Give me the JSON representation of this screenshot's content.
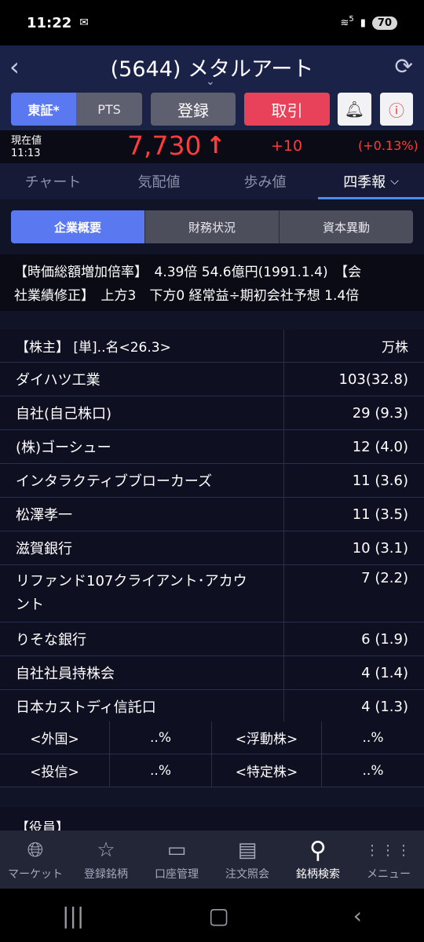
{
  "status": {
    "time": "11:22",
    "battery": "70",
    "signal_label": "5"
  },
  "header": {
    "title": "(5644) メタルアート"
  },
  "actions": {
    "tosho": "東証*",
    "pts": "PTS",
    "register": "登録",
    "trade": "取引"
  },
  "price": {
    "label": "現在値",
    "time": "11:13",
    "value": "7,730",
    "change": "+10",
    "pct": "(+0.13%)"
  },
  "tabs": [
    "チャート",
    "気配値",
    "歩み値",
    "四季報"
  ],
  "subtabs": [
    "企業概要",
    "財務状況",
    "資本異動"
  ],
  "summary": {
    "line1": "【時価総額増加倍率】　4.39倍 54.6億円(1991.1.4)　【会",
    "line2": "社業績修正】　上方3　下方0 経常益÷期初会社予想 1.4倍"
  },
  "holders": {
    "header_name": "【株主】 [単]..名<26.3>",
    "header_unit": "万株",
    "rows": [
      {
        "name": "ダイハツ工業",
        "value": "103(32.8)"
      },
      {
        "name": "自社(自己株口)",
        "value": "29 (9.3)"
      },
      {
        "name": "(株)ゴーシュー",
        "value": "12 (4.0)"
      },
      {
        "name": "インタラクティブブローカーズ",
        "value": "11 (3.6)"
      },
      {
        "name": "松澤孝一",
        "value": "11 (3.5)"
      },
      {
        "name": "滋賀銀行",
        "value": "10 (3.1)"
      },
      {
        "name": "リファンド107クライアント･アカウ",
        "name2": "ント",
        "value": "7 (2.2)"
      },
      {
        "name": "りそな銀行",
        "value": "6 (1.9)"
      },
      {
        "name": "自社社員持株会",
        "value": "4 (1.4)"
      },
      {
        "name": "日本カストディ信託口",
        "value": "4 (1.3)"
      }
    ]
  },
  "stats": [
    {
      "l1": "<外国>",
      "v1": "..%",
      "l2": "<浮動株>",
      "v2": "..%"
    },
    {
      "l1": "<投信>",
      "v1": "..%",
      "l2": "<特定株>",
      "v2": "..%"
    }
  ],
  "officers": {
    "title": "【役員】"
  },
  "nav": [
    "マーケット",
    "登録銘柄",
    "口座管理",
    "注文照会",
    "銘柄検索",
    "メニュー"
  ]
}
